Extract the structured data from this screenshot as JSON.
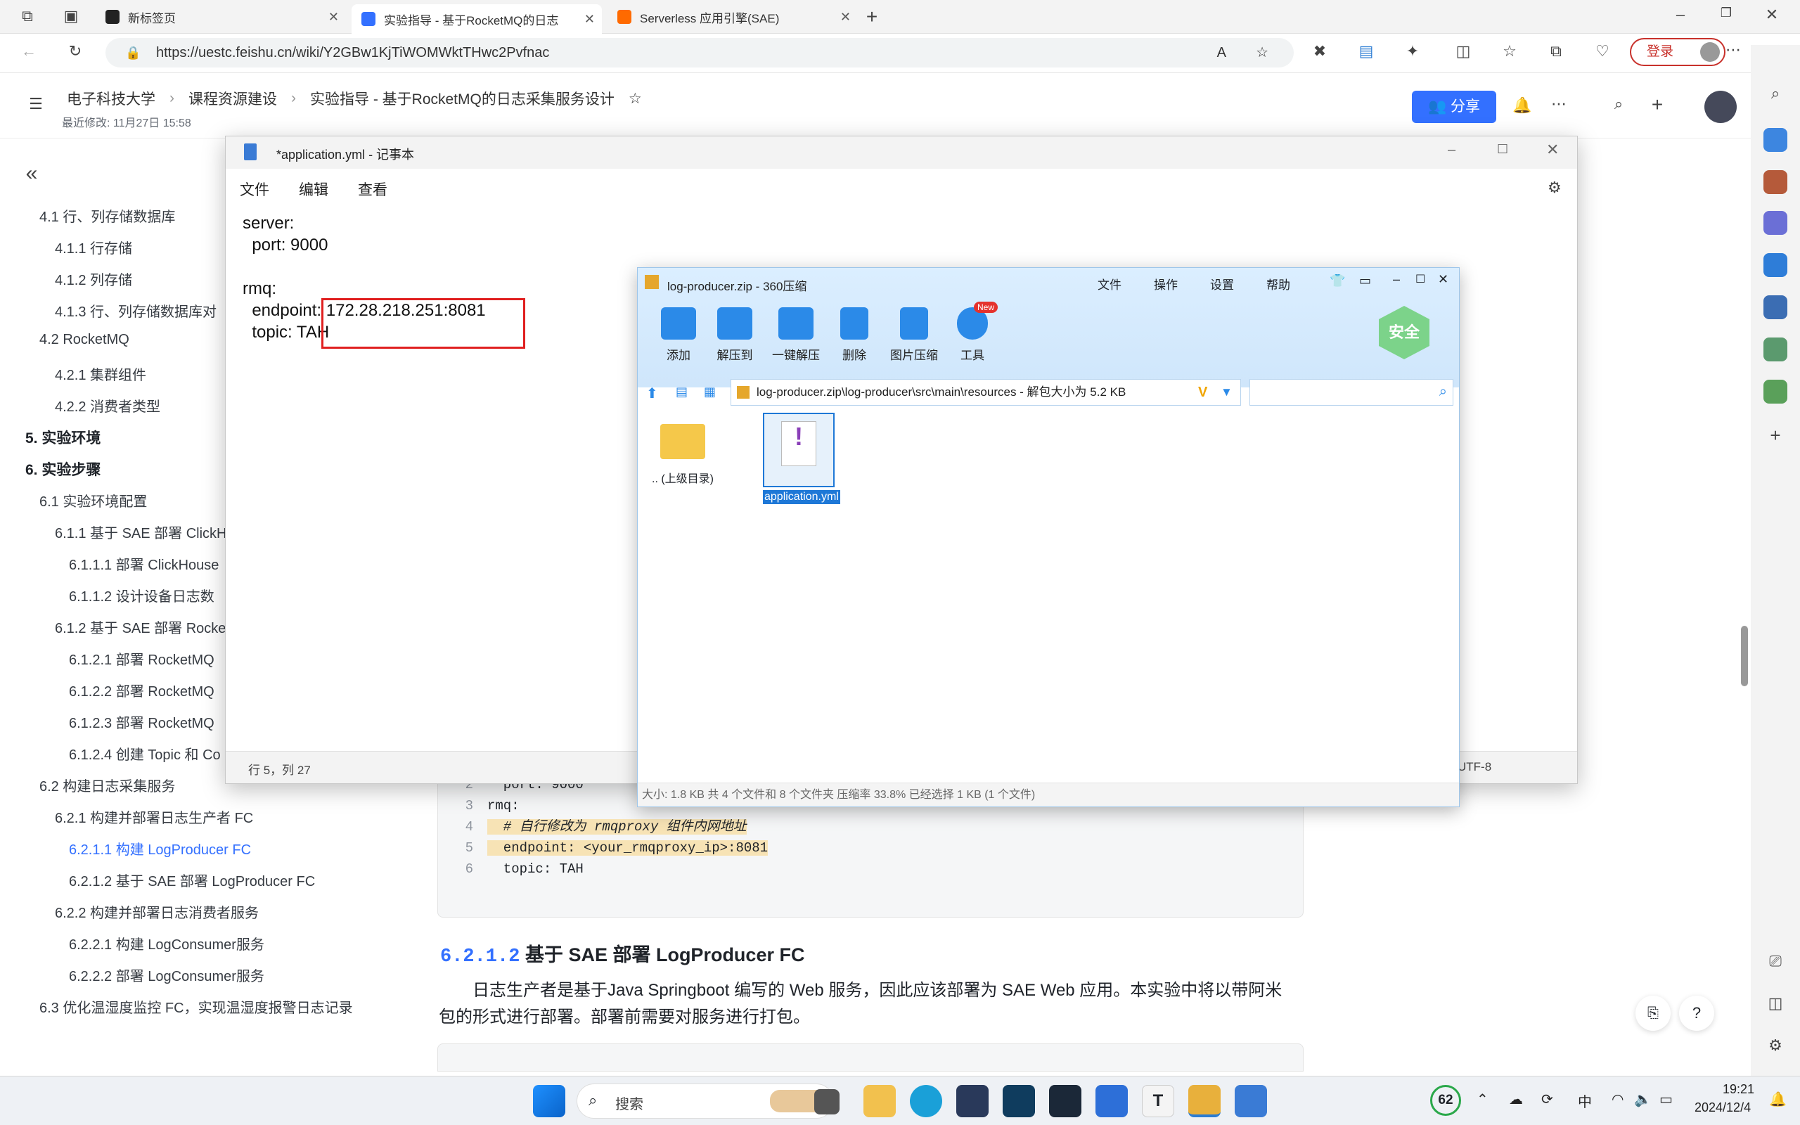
{
  "browser": {
    "tabs": [
      {
        "label": "新标签页",
        "active": false
      },
      {
        "label": "实验指导 - 基于RocketMQ的日志",
        "active": true
      },
      {
        "label": "Serverless 应用引擎(SAE)",
        "active": false
      }
    ],
    "url": "https://uestc.feishu.cn/wiki/Y2GBw1KjTiWOMWktTHwc2Pvfnac",
    "login_label": "登录"
  },
  "feishu": {
    "breadcrumb": [
      "电子科技大学",
      "课程资源建设",
      "实验指导 - 基于RocketMQ的日志采集服务设计"
    ],
    "last_modified": "最近修改: 11月27日 15:58",
    "share_label": "分享"
  },
  "sidebar": {
    "items": [
      {
        "text": "4.1 行、列存储数据库",
        "level": 2
      },
      {
        "text": "4.1.1 行存储",
        "level": 3
      },
      {
        "text": "4.1.2 列存储",
        "level": 3
      },
      {
        "text": "4.1.3 行、列存储数据库对",
        "level": 3
      },
      {
        "text": "4.2 RocketMQ",
        "level": 2
      },
      {
        "text": "4.2.1 集群组件",
        "level": 3
      },
      {
        "text": "4.2.2 消费者类型",
        "level": 3
      },
      {
        "text": "5. 实验环境",
        "level": 1
      },
      {
        "text": "6. 实验步骤",
        "level": 1
      },
      {
        "text": "6.1 实验环境配置",
        "level": 2
      },
      {
        "text": "6.1.1 基于 SAE 部署 ClickH",
        "level": 3
      },
      {
        "text": "6.1.1.1 部署 ClickHouse",
        "level": 4
      },
      {
        "text": "6.1.1.2 设计设备日志数",
        "level": 4
      },
      {
        "text": "6.1.2 基于 SAE 部署 Rocke",
        "level": 3
      },
      {
        "text": "6.1.2.1 部署 RocketMQ",
        "level": 4
      },
      {
        "text": "6.1.2.2 部署 RocketMQ",
        "level": 4
      },
      {
        "text": "6.1.2.3 部署 RocketMQ",
        "level": 4
      },
      {
        "text": "6.1.2.4 创建 Topic 和 Co",
        "level": 4
      },
      {
        "text": "6.2 构建日志采集服务",
        "level": 2
      },
      {
        "text": "6.2.1 构建并部署日志生产者 FC",
        "level": 3
      },
      {
        "text": "6.2.1.1 构建 LogProducer FC",
        "level": 4,
        "active": true
      },
      {
        "text": "6.2.1.2 基于 SAE 部署 LogProducer FC",
        "level": 4
      },
      {
        "text": "6.2.2 构建并部署日志消费者服务",
        "level": 3
      },
      {
        "text": "6.2.2.1 构建 LogConsumer服务",
        "level": 4
      },
      {
        "text": "6.2.2.2 部署 LogConsumer服务",
        "level": 4
      },
      {
        "text": "6.3 优化温湿度监控 FC，实现温湿度报警日志记录",
        "level": 2
      }
    ]
  },
  "doc": {
    "code_lines": [
      {
        "n": "2",
        "code": "  port: 9000"
      },
      {
        "n": "3",
        "code": "rmq:"
      },
      {
        "n": "4",
        "code": "  # 自行修改为 rmqproxy 组件内网地址"
      },
      {
        "n": "5",
        "code": "  endpoint: <your_rmqproxy_ip>:8081"
      },
      {
        "n": "6",
        "code": "  topic: TAH"
      }
    ],
    "section_number": "6.2.1.2",
    "section_title": "基于 SAE 部署 LogProducer FC",
    "paragraph_1": "日志生产者是基于Java Springboot 编写的 Web 服务，因此应该部署为 SAE Web 应用。本实验中将以带阿米",
    "paragraph_2": "包的形式进行部署。部署前需要对服务进行打包。"
  },
  "notepad": {
    "title": "*application.yml - 记事本",
    "menu": [
      "文件",
      "编辑",
      "查看"
    ],
    "lines": [
      "server:",
      "  port: 9000",
      "",
      "rmq:",
      "  endpoint: 172.28.218.251:8081",
      "  topic: TAH"
    ],
    "status_position": "行 5，列 27",
    "status_encoding": "UTF-8"
  },
  "zip": {
    "title": "log-producer.zip - 360压缩",
    "menu": [
      "文件",
      "操作",
      "设置",
      "帮助"
    ],
    "toolbar": [
      "添加",
      "解压到",
      "一键解压",
      "删除",
      "图片压缩",
      "工具"
    ],
    "new_badge": "New",
    "safe_label": "安全",
    "path": "log-producer.zip\\log-producer\\src\\main\\resources - 解包大小为 5.2 KB",
    "files": [
      {
        "name": ".. (上级目录)",
        "type": "folder"
      },
      {
        "name": "application.yml",
        "type": "file",
        "selected": true
      }
    ],
    "status": "大小: 1.8 KB 共 4 个文件和 8 个文件夹 压缩率 33.8% 已经选择 1 KB (1 个文件)"
  },
  "taskbar": {
    "search_placeholder": "搜索",
    "badge": "62",
    "ime": "中",
    "time": "19:21",
    "date": "2024/12/4"
  }
}
